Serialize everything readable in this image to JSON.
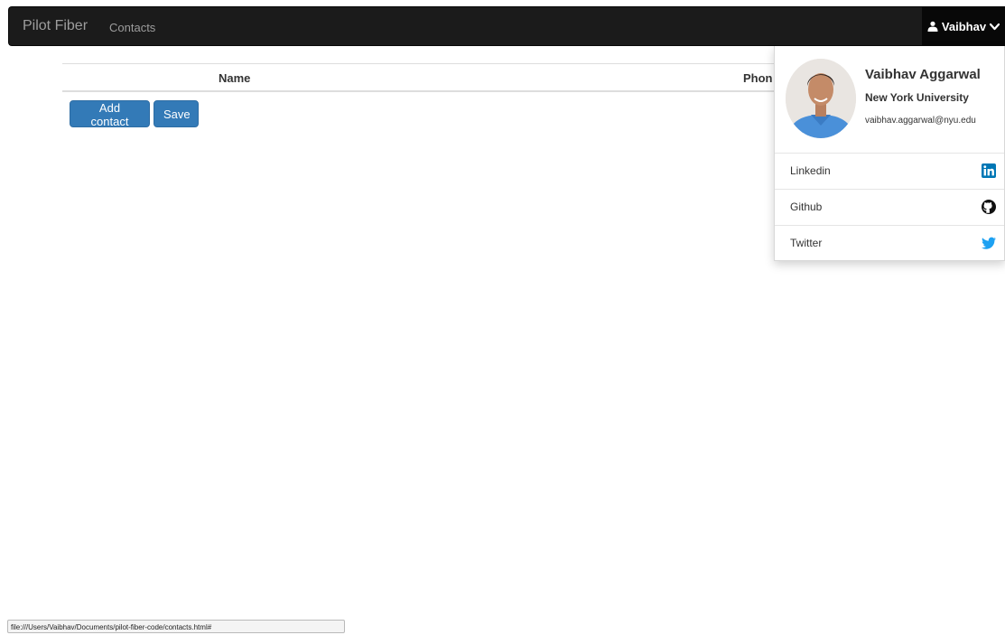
{
  "navbar": {
    "brand": "Pilot Fiber",
    "contacts_link": "Contacts",
    "user_label": "Vaibhav",
    "user_icon": "user-icon",
    "toggle_icon": "chevron-down-icon"
  },
  "table": {
    "headers": [
      "Name",
      "Phon"
    ]
  },
  "buttons": {
    "add_contact": "Add contact",
    "save": "Save",
    "color": "#337ab7"
  },
  "profile": {
    "name": "Vaibhav Aggarwal",
    "organization": "New York University",
    "email": "vaibhav.aggarwal@nyu.edu"
  },
  "menu": {
    "items": [
      {
        "label": "Linkedin",
        "icon": "linkedin-icon",
        "color": "#0077b5"
      },
      {
        "label": "Github",
        "icon": "github-icon",
        "color": "#111111"
      },
      {
        "label": "Twitter",
        "icon": "twitter-icon",
        "color": "#1da1f2"
      }
    ]
  },
  "status_bar": {
    "url": "file:///Users/Vaibhav/Documents/pilot-fiber-code/contacts.html#"
  }
}
